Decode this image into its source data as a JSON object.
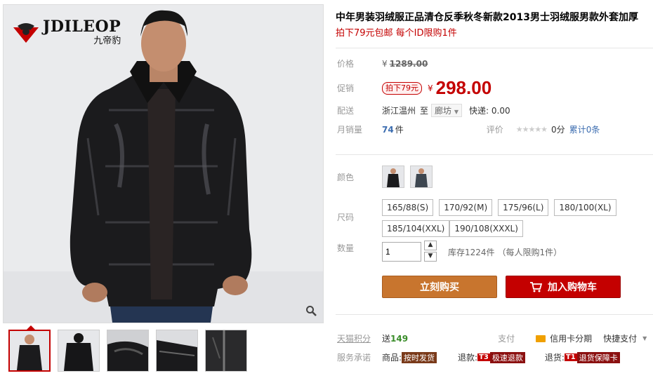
{
  "brand": {
    "name": "JDILEOP",
    "sub": "九帝豹"
  },
  "product": {
    "title": "中年男装羽绒服正品清仓反季秋冬新款2013男士羽绒服男款外套加厚",
    "subtitle": "拍下79元包邮 每个ID限购1件"
  },
  "price": {
    "label": "价格",
    "yen": "¥",
    "original": "1289.00"
  },
  "promo": {
    "label": "促销",
    "tag": "拍下79元",
    "yen": "¥",
    "value": "298.00"
  },
  "shipping": {
    "label": "配送",
    "from": "浙江温州",
    "to_word": "至",
    "dest": "廊坊",
    "fee": "快递: 0.00"
  },
  "sales": {
    "label": "月销量",
    "count": "74",
    "unit": "件",
    "review_label": "评价",
    "stars": "★★★★★",
    "score": "0分",
    "total": "累计0条"
  },
  "color": {
    "label": "颜色"
  },
  "sizes": {
    "label": "尺码",
    "options": [
      "165/88(S)",
      "170/92(M)",
      "175/96(L)",
      "180/100(XL)",
      "185/104(XXL)",
      "190/108(XXXL)"
    ]
  },
  "quantity": {
    "label": "数量",
    "value": "1",
    "stock": "库存1224件",
    "limit": "（每人限购1件）"
  },
  "actions": {
    "buy": "立刻购买",
    "cart": "加入购物车"
  },
  "points": {
    "label": "天猫积分",
    "send": "送",
    "value": "149"
  },
  "pay": {
    "label": "支付",
    "credit": "信用卡分期",
    "fast": "快捷支付"
  },
  "service": {
    "label": "服务承诺",
    "goods": "商品:",
    "goods_tag": "按时发货",
    "refund": "退款:",
    "refund_tag_num": "T3",
    "refund_tag": "极速退款",
    "return": "退货:",
    "return_tag_num": "T1",
    "return_tag": "退货保障卡"
  },
  "colors": {
    "accent": "#c40000",
    "buy": "#c8752e"
  }
}
